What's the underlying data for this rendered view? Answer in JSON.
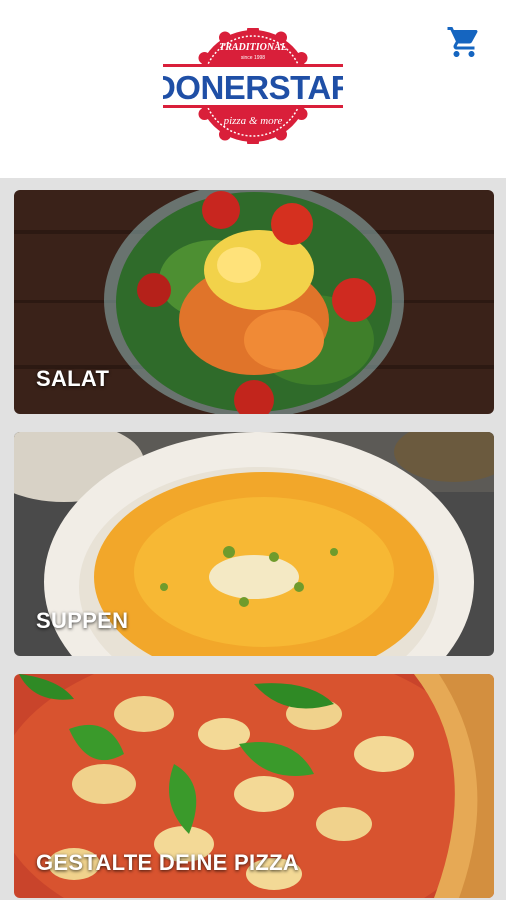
{
  "brand": {
    "name": "DONERSTAR",
    "arc_top": "TRADITIONAL",
    "since": "since 1998",
    "arc_bottom": "pizza & more",
    "colors": {
      "primary": "#d91f3a",
      "accent": "#1f4fa6"
    }
  },
  "header": {
    "cart_icon": "shopping-cart-icon",
    "cart_color": "#1565c0"
  },
  "categories": [
    {
      "label": "SALAT"
    },
    {
      "label": "SUPPEN"
    },
    {
      "label": "GESTALTE DEINE PIZZA"
    }
  ]
}
